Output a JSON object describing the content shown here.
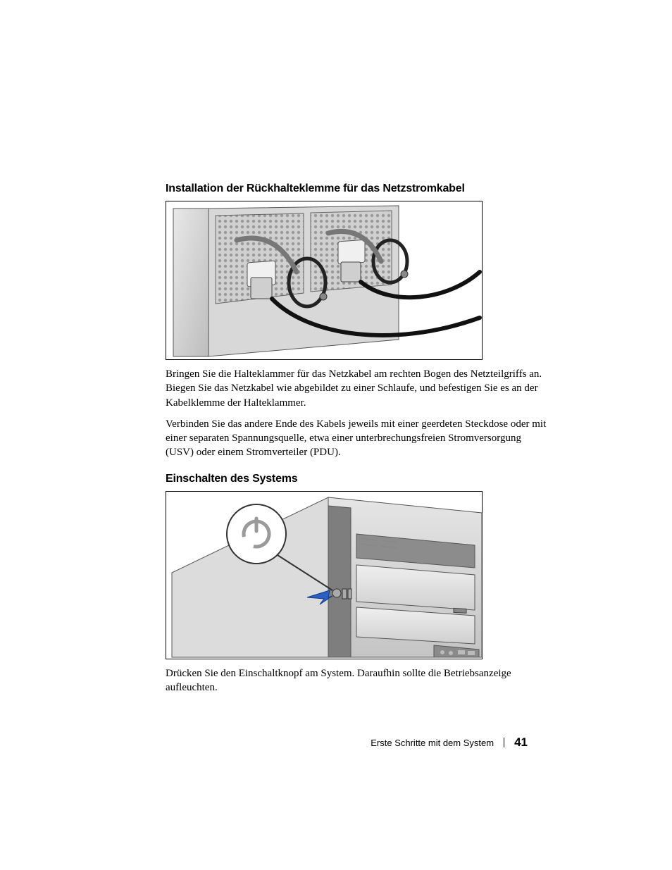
{
  "section1": {
    "heading": "Installation der Rückhalteklemme für das Netzstromkabel",
    "para1": "Bringen Sie die Halteklammer für das Netzkabel am rechten Bogen des Netz­teilgriffs an. Biegen Sie das Netzkabel wie abgebildet zu einer Schlaufe, und befestigen Sie es an der Kabelklemme der Halteklammer.",
    "para2": "Verbinden Sie das andere Ende des Kabels jeweils mit einer geerdeten Steckdose oder mit einer separaten Spannungsquelle, etwa einer unterbrechungsfreien Stromversorgung (USV) oder einem Stromverteiler (PDU)."
  },
  "section2": {
    "heading": "Einschalten des Systems",
    "para1": "Drücken Sie den Einschaltknopf am System. Daraufhin sollte die Betriebs­anzeige aufleuchten."
  },
  "footer": {
    "title": "Erste Schritte mit dem System",
    "page": "41"
  }
}
